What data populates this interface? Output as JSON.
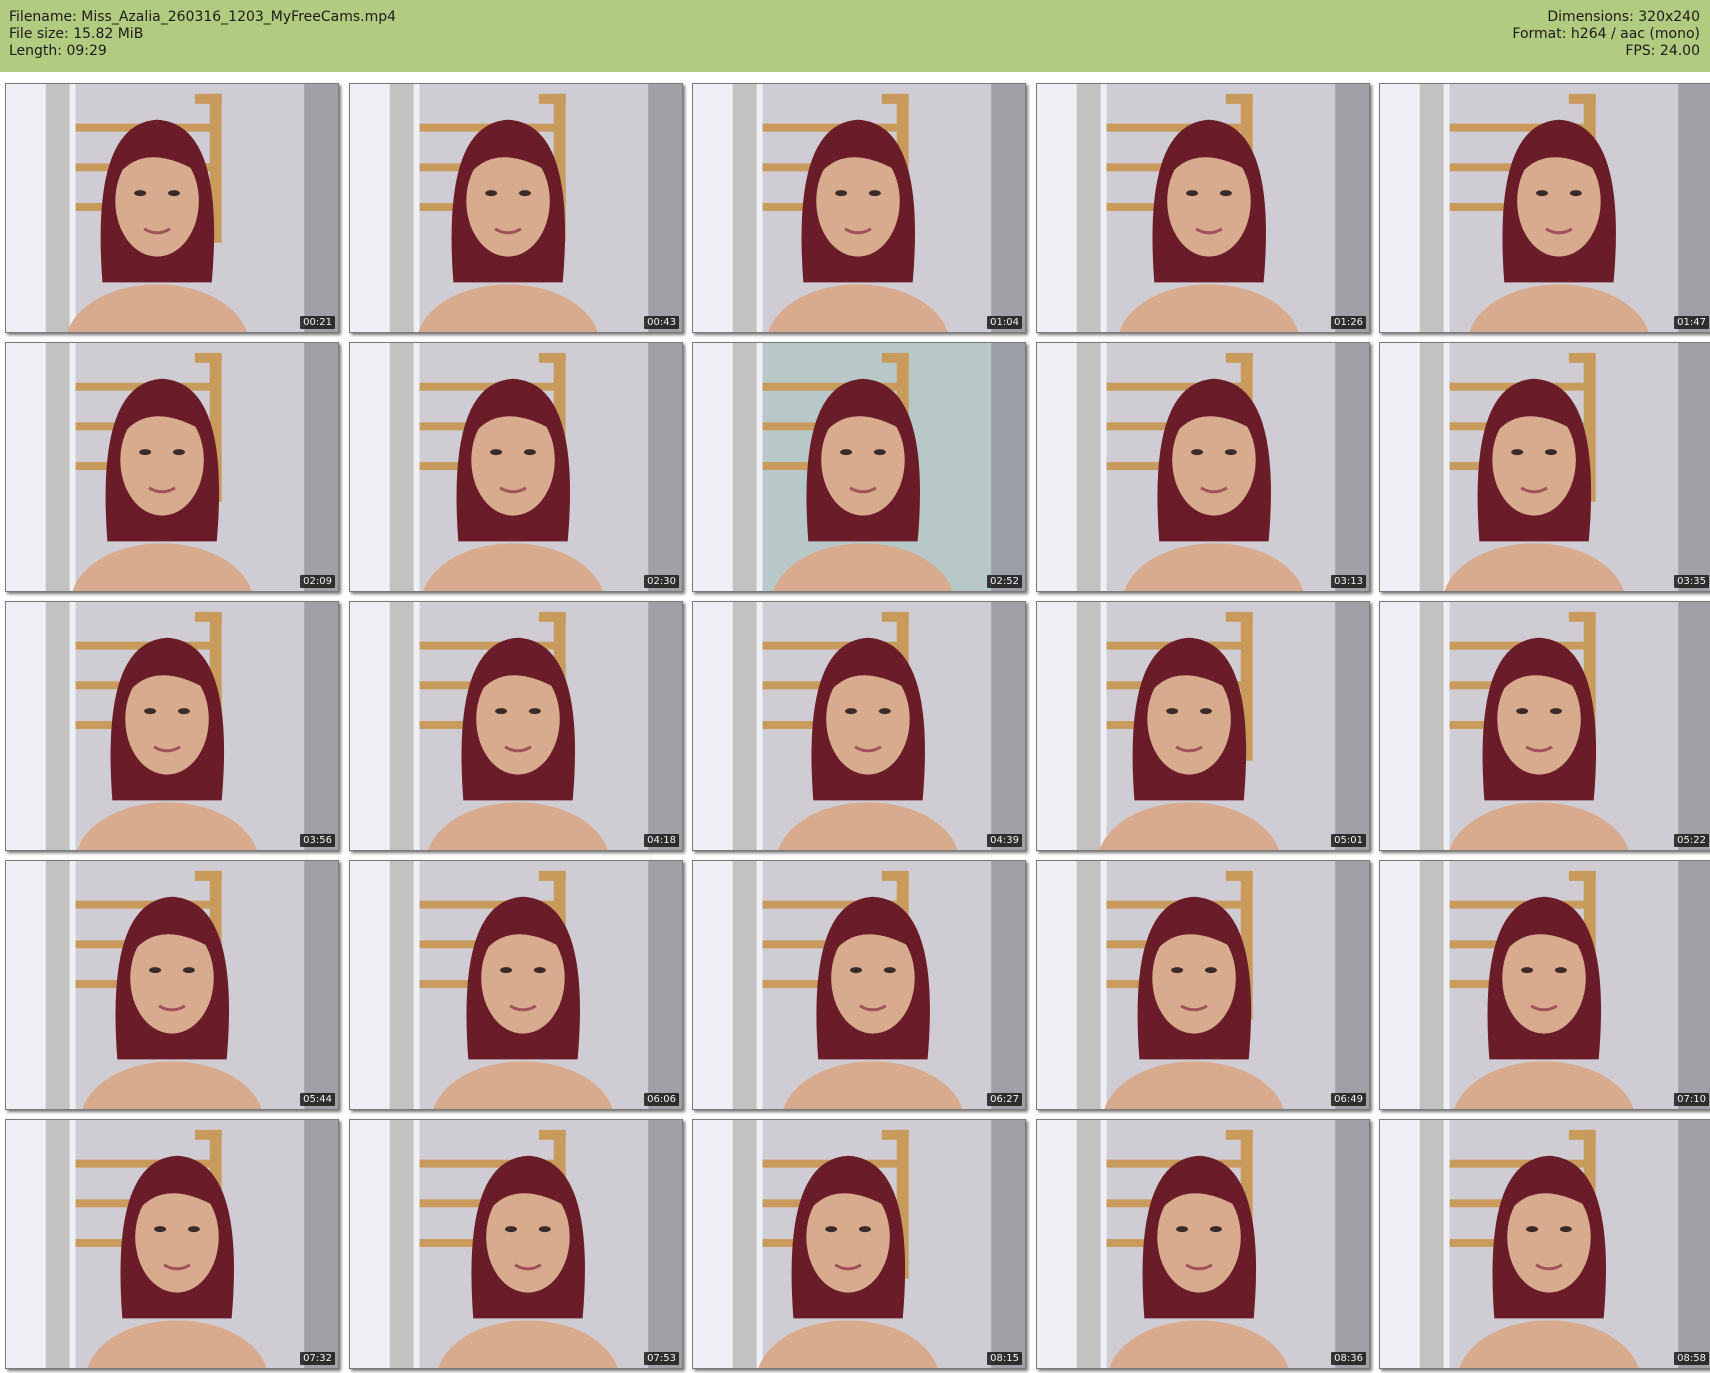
{
  "header": {
    "filename": "Filename: Miss_Azalia_260316_1203_MyFreeCams.mp4",
    "filesize": "File size: 15.82 MiB",
    "length": "Length: 09:29",
    "dimensions": "Dimensions: 320x240",
    "format": "Format: h264 / aac (mono)",
    "fps": "FPS: 24.00"
  },
  "colors": {
    "header_bg": "#b1cc80",
    "wall": "#cfccd4",
    "shelf": "#c89a5c",
    "hair": "#6a1d28",
    "skin": "#d8aa8e",
    "window": "#eef0f6",
    "timestamp_bg": "#141414"
  },
  "thumbnails": [
    {
      "time": "00:21",
      "icon": "video-frame"
    },
    {
      "time": "00:43",
      "icon": "video-frame"
    },
    {
      "time": "01:04",
      "icon": "video-frame"
    },
    {
      "time": "01:26",
      "icon": "video-frame"
    },
    {
      "time": "01:47",
      "icon": "video-frame"
    },
    {
      "time": "02:09",
      "icon": "video-frame"
    },
    {
      "time": "02:30",
      "icon": "video-frame"
    },
    {
      "time": "02:52",
      "icon": "video-frame",
      "tint": "#b8c8c8"
    },
    {
      "time": "03:13",
      "icon": "video-frame"
    },
    {
      "time": "03:35",
      "icon": "video-frame"
    },
    {
      "time": "03:56",
      "icon": "video-frame"
    },
    {
      "time": "04:18",
      "icon": "video-frame"
    },
    {
      "time": "04:39",
      "icon": "video-frame"
    },
    {
      "time": "05:01",
      "icon": "video-frame"
    },
    {
      "time": "05:22",
      "icon": "video-frame"
    },
    {
      "time": "05:44",
      "icon": "video-frame"
    },
    {
      "time": "06:06",
      "icon": "video-frame"
    },
    {
      "time": "06:27",
      "icon": "video-frame"
    },
    {
      "time": "06:49",
      "icon": "video-frame"
    },
    {
      "time": "07:10",
      "icon": "video-frame"
    },
    {
      "time": "07:32",
      "icon": "video-frame"
    },
    {
      "time": "07:53",
      "icon": "video-frame"
    },
    {
      "time": "08:15",
      "icon": "video-frame"
    },
    {
      "time": "08:36",
      "icon": "video-frame"
    },
    {
      "time": "08:58",
      "icon": "video-frame"
    }
  ]
}
